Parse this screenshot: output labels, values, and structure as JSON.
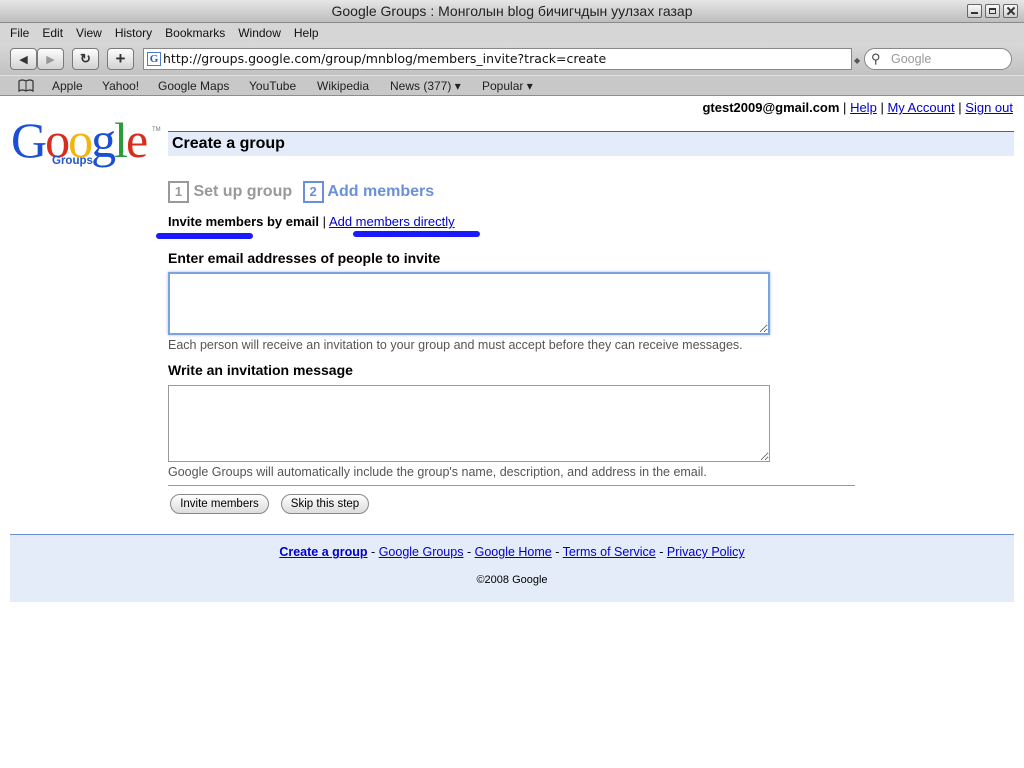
{
  "window": {
    "title": "Google Groups : Монголын blog бичигчдын уулзах газар"
  },
  "menu": [
    "File",
    "Edit",
    "View",
    "History",
    "Bookmarks",
    "Window",
    "Help"
  ],
  "toolbar": {
    "back_icon": "◀",
    "forward_icon": "▶",
    "reload_icon": "↻",
    "add_icon": "+",
    "url": "http://groups.google.com/group/mnblog/members_invite?track=create",
    "favicon": "G",
    "search_placeholder": "Google"
  },
  "bookmarks": {
    "items": [
      "Apple",
      "Yahoo!",
      "Google Maps",
      "YouTube",
      "Wikipedia",
      "News (377) ▾",
      "Popular ▾"
    ]
  },
  "userbar": {
    "email": "gtest2009@gmail.com",
    "sep": "|",
    "help": "Help",
    "account": "My Account",
    "signout": "Sign out"
  },
  "logo": {
    "letters": [
      "G",
      "o",
      "o",
      "g",
      "l",
      "e"
    ],
    "letter_colors": [
      "#1a4fd6",
      "#d62d20",
      "#f2b50f",
      "#1a4fd6",
      "#2a9a3a",
      "#d62d20"
    ],
    "product": "Groups",
    "tm": "TM"
  },
  "header": {
    "title": "Create a group"
  },
  "steps": {
    "step1_num": "1",
    "step1_label": "Set up group",
    "step2_num": "2",
    "step2_label": "Add members"
  },
  "invite_tabs": {
    "active": "Invite members by email",
    "sep": "|",
    "other": "Add members directly"
  },
  "form": {
    "emails_label": "Enter email addresses of people to invite",
    "emails_value": "",
    "emails_note": "Each person will receive an invitation to your group and must accept before they can receive messages.",
    "message_label": "Write an invitation message",
    "message_value": "",
    "message_note": "Google Groups will automatically include the group's name, description, and address in the email.",
    "invite_button": "Invite members",
    "skip_button": "Skip this step"
  },
  "footer": {
    "create_group": "Create a group",
    "groups": "Google Groups",
    "home": "Google Home",
    "terms": "Terms of Service",
    "privacy": "Privacy Policy",
    "dash": "-",
    "copyright": "©2008 Google"
  },
  "colors": {
    "link": "#0000cc",
    "header_bg": "#e5ecf9",
    "marker": "#1a1aff",
    "step_active": "#6b90da"
  }
}
